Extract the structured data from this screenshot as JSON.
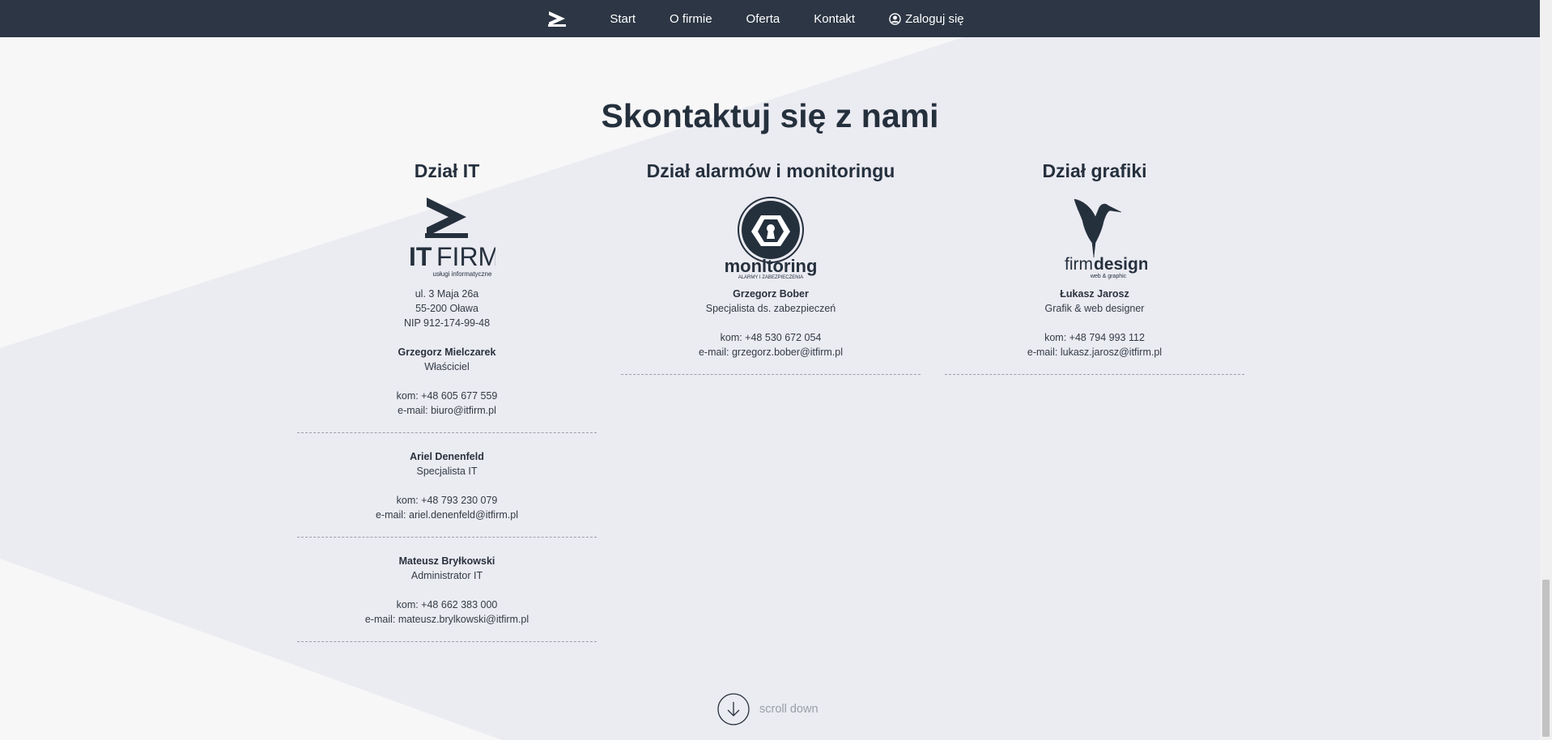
{
  "nav": {
    "items": [
      "Start",
      "O firmie",
      "Oferta",
      "Kontakt"
    ],
    "login_label": "Zaloguj się"
  },
  "page_title": "Skontaktuj się z nami",
  "columns": {
    "it": {
      "title": "Dział IT",
      "logo": {
        "text_bold": "IT",
        "text_light": "FIRM",
        "tagline": "usługi informatyczne"
      },
      "address": [
        "ul. 3 Maja 26a",
        "55-200 Oława",
        "NIP 912-174-99-48"
      ],
      "people": [
        {
          "name": "Grzegorz Mielczarek",
          "role": "Właściciel",
          "phone": "kom: +48 605 677 559",
          "email": "e-mail: biuro@itfirm.pl"
        },
        {
          "name": "Ariel Denenfeld",
          "role": "Specjalista IT",
          "phone": "kom: +48 793 230 079",
          "email": "e-mail: ariel.denenfeld@itfirm.pl"
        },
        {
          "name": "Mateusz Bryłkowski",
          "role": "Administrator IT",
          "phone": "kom: +48 662 383 000",
          "email": "e-mail: mateusz.brylkowski@itfirm.pl"
        }
      ]
    },
    "monitoring": {
      "title": "Dział alarmów i monitoringu",
      "logo": {
        "text": "monitoring",
        "tagline": "ALARMY I ZABEZPIECZENIA"
      },
      "people": [
        {
          "name": "Grzegorz Bober",
          "role": "Specjalista ds. zabezpieczeń",
          "phone": "kom: +48 530 672 054",
          "email": "e-mail: grzegorz.bober@itfirm.pl"
        }
      ]
    },
    "graphics": {
      "title": "Dział grafiki",
      "logo": {
        "text_light": "firm",
        "text_bold": "design",
        "tagline": "web & graphic"
      },
      "people": [
        {
          "name": "Łukasz Jarosz",
          "role": "Grafik & web designer",
          "phone": "kom: +48 794 993 112",
          "email": "e-mail: lukasz.jarosz@itfirm.pl"
        }
      ]
    }
  },
  "scroll_label": "scroll down",
  "colors": {
    "nav_bg": "#2c3644",
    "title": "#25303d",
    "bg_light": "#f7f7f8",
    "bg_shape": "#ebebf2"
  },
  "icons": [
    "brand-chevron-icon",
    "user-circle-icon",
    "keyhole-shutter-icon",
    "hummingbird-icon",
    "arrow-down-circle-icon"
  ]
}
